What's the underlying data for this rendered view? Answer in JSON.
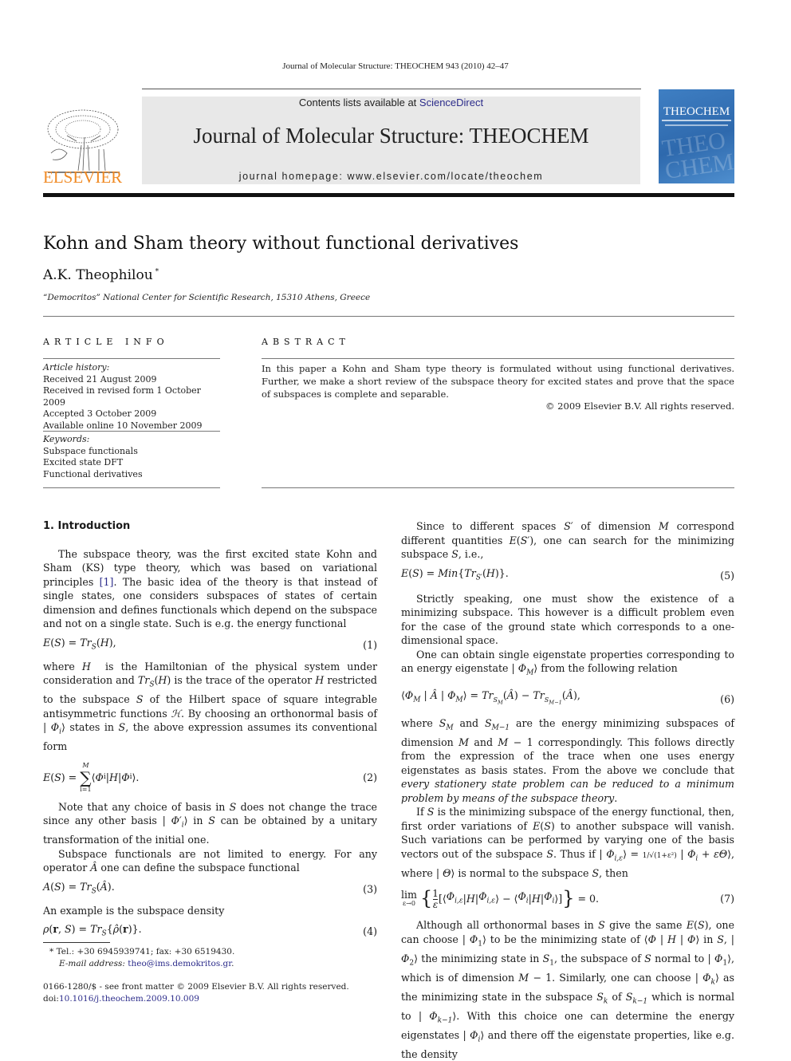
{
  "running_head": "Journal of Molecular Structure: THEOCHEM 943 (2010) 42–47",
  "banner": {
    "contents_prefix": "Contents lists available at ",
    "contents_link": "ScienceDirect",
    "journal_title": "Journal of Molecular Structure: THEOCHEM",
    "homepage": "journal homepage: www.elsevier.com/locate/theochem",
    "publisher_logo_text": "ELSEVIER",
    "cover_title": "THEOCHEM",
    "cover_watermark": "THEO CHEM",
    "colors": {
      "elsevier_orange": "#f08a24",
      "link_blue": "#2b2b8a",
      "cover_blue": "#3f7fc3",
      "banner_gray": "#e8e8e8"
    }
  },
  "article": {
    "title": "Kohn and Sham theory without functional derivatives",
    "author": "A.K. Theophilou",
    "author_mark": "*",
    "affiliation": "“Democritos” National Center for Scientific Research, 15310 Athens, Greece"
  },
  "article_info": {
    "heading": "ARTICLE INFO",
    "history_label": "Article history:",
    "history": [
      "Received 21 August 2009",
      "Received in revised form 1 October 2009",
      "Accepted 3 October 2009",
      "Available online 10 November 2009"
    ],
    "keywords_label": "Keywords:",
    "keywords": [
      "Subspace functionals",
      "Excited state DFT",
      "Functional derivatives"
    ]
  },
  "abstract": {
    "heading": "ABSTRACT",
    "text": "In this paper a Kohn and Sham type theory is formulated without using functional derivatives. Further, we make a short review of the subspace theory for excited states and prove that the space of subspaces is complete and separable.",
    "copyright": "© 2009 Elsevier B.V. All rights reserved."
  },
  "body": {
    "section1_title": "1. Introduction",
    "p1": "The subspace theory, was the first excited state Kohn and Sham (KS) type theory, which was based on variational principles ",
    "p1_ref": "[1]",
    "p1_rest": ". The basic idea of the theory is that instead of single states, one considers subspaces of states of certain dimension and defines functionals which depend on the subspace and not on a single state. Such is e.g. the energy functional",
    "eq1": "E(S) = Tr_S(H),",
    "eq1_num": "(1)",
    "p2": "where H is the Hamiltonian of the physical system under consideration and Tr_S(H) is the trace of the operator H restricted to the subspace S of the Hilbert space of square integrable antisymmetric functions ℋ. By choosing an orthonormal basis of | Φi⟩ states in S, the above expression assumes its conventional form",
    "eq2": "E(S) = Σ_{i=1}^{M} ⟨Φi | H | Φi⟩.",
    "eq2_num": "(2)",
    "p3": "Note that any choice of basis in S does not change the trace since any other basis | Φ′i⟩ in S can be obtained by a unitary transformation of the initial one.",
    "p4": "Subspace functionals are not limited to energy. For any operator Â one can define the subspace functional",
    "eq3": "A(S) = Tr_S(Â).",
    "eq3_num": "(3)",
    "p5": "An example is the subspace density",
    "eq4": "ρ(r, S) = Tr_S{ρ̂(r)}.",
    "eq4_num": "(4)",
    "p6": "Since to different spaces S′ of dimension M correspond different quantities E(S′), one can search for the minimizing subspace S, i.e.,",
    "eq5": "E(S) = Min{Tr_S′(H)}.",
    "eq5_num": "(5)",
    "p7": "Strictly speaking, one must show the existence of a minimizing subspace. This however is a difficult problem even for the case of the ground state which corresponds to a one-dimensional space.",
    "p8": "One can obtain single eigenstate properties corresponding to an energy eigenstate | ΦM⟩ from the following relation",
    "eq6": "⟨ΦM | Â | ΦM⟩ = Tr_SM(Â) − Tr_SM−1(Â),",
    "eq6_num": "(6)",
    "p9": "where SM and SM−1 are the energy minimizing subspaces of dimension M and M − 1 correspondingly. This follows directly from the expression of the trace when one uses energy eigenstates as basis states. From the above we conclude that ",
    "p9_italic": "every stationery state problem can be reduced to a minimum problem by means of the subspace theory",
    "p9_end": ".",
    "p10": "If S is the minimizing subspace of the energy functional, then, first order variations of E(S) to another subspace will vanish. Such variations can be performed by varying one of the basis vectors out of the subspace S. Thus if | Φi,ε⟩ = 1/√(1+ε²) | Φi + εΘ⟩, where | Θ⟩ is normal to the subspace S, then",
    "eq7": "lim_{ε→0} { (1/ε) [⟨Φi,ε | H | Φi,ε⟩ − ⟨Φi | H | Φi⟩] } = 0.",
    "eq7_num": "(7)",
    "p11": "Although all orthonormal bases in S give the same E(S), one can choose | Φ1⟩ to be the minimizing state of ⟨Φ | H | Φ⟩ in S, | Φ2⟩ the minimizing state in S1, the subspace of S normal to | Φ1⟩, which is of dimension M − 1. Similarly, one can choose | Φk⟩ as the minimizing state in the subspace Sk of Sk−1 which is normal to | Φk−1⟩. With this choice one can determine the energy eigenstates | Φi⟩ and there off the eigenstate properties, like e.g. the density"
  },
  "footnote": {
    "tel": "* Tel.: +30 6945939741; fax: +30 6519430.",
    "email_label": "E-mail address: ",
    "email": "theo@ims.demokritos.gr",
    "email_end": ".",
    "issn": "0166-1280/$ - see front matter © 2009 Elsevier B.V. All rights reserved.",
    "doi_label": "doi:",
    "doi": "10.1016/j.theochem.2009.10.009"
  }
}
